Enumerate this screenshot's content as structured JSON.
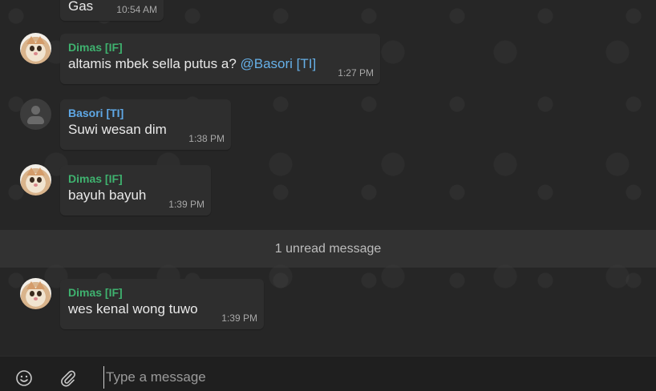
{
  "messages": [
    {
      "sender": "",
      "text": "Gas",
      "time": "10:54 AM",
      "avatar": "none"
    },
    {
      "sender": "Dimas [IF]",
      "text_before": "altamis mbek sella putus a? ",
      "mention": "@Basori [TI]",
      "time": "1:27 PM",
      "avatar": "cat"
    },
    {
      "sender": "Basori [TI]",
      "text": "Suwi wesan dim",
      "time": "1:38 PM",
      "avatar": "default"
    },
    {
      "sender": "Dimas [IF]",
      "text": "bayuh bayuh",
      "time": "1:39 PM",
      "avatar": "cat"
    },
    {
      "sender": "Dimas [IF]",
      "text": "wes kenal wong tuwo",
      "time": "1:39 PM",
      "avatar": "cat"
    }
  ],
  "unread_banner": "1 unread message",
  "compose": {
    "placeholder": "Type a message",
    "emoji_icon": "emoji-icon",
    "attach_icon": "paperclip-icon"
  },
  "colors": {
    "sender_green": "#3fb26f",
    "sender_blue": "#5fa8e6",
    "mention": "#66b0e8",
    "bubble": "#2e2e2e",
    "background": "#262626"
  }
}
